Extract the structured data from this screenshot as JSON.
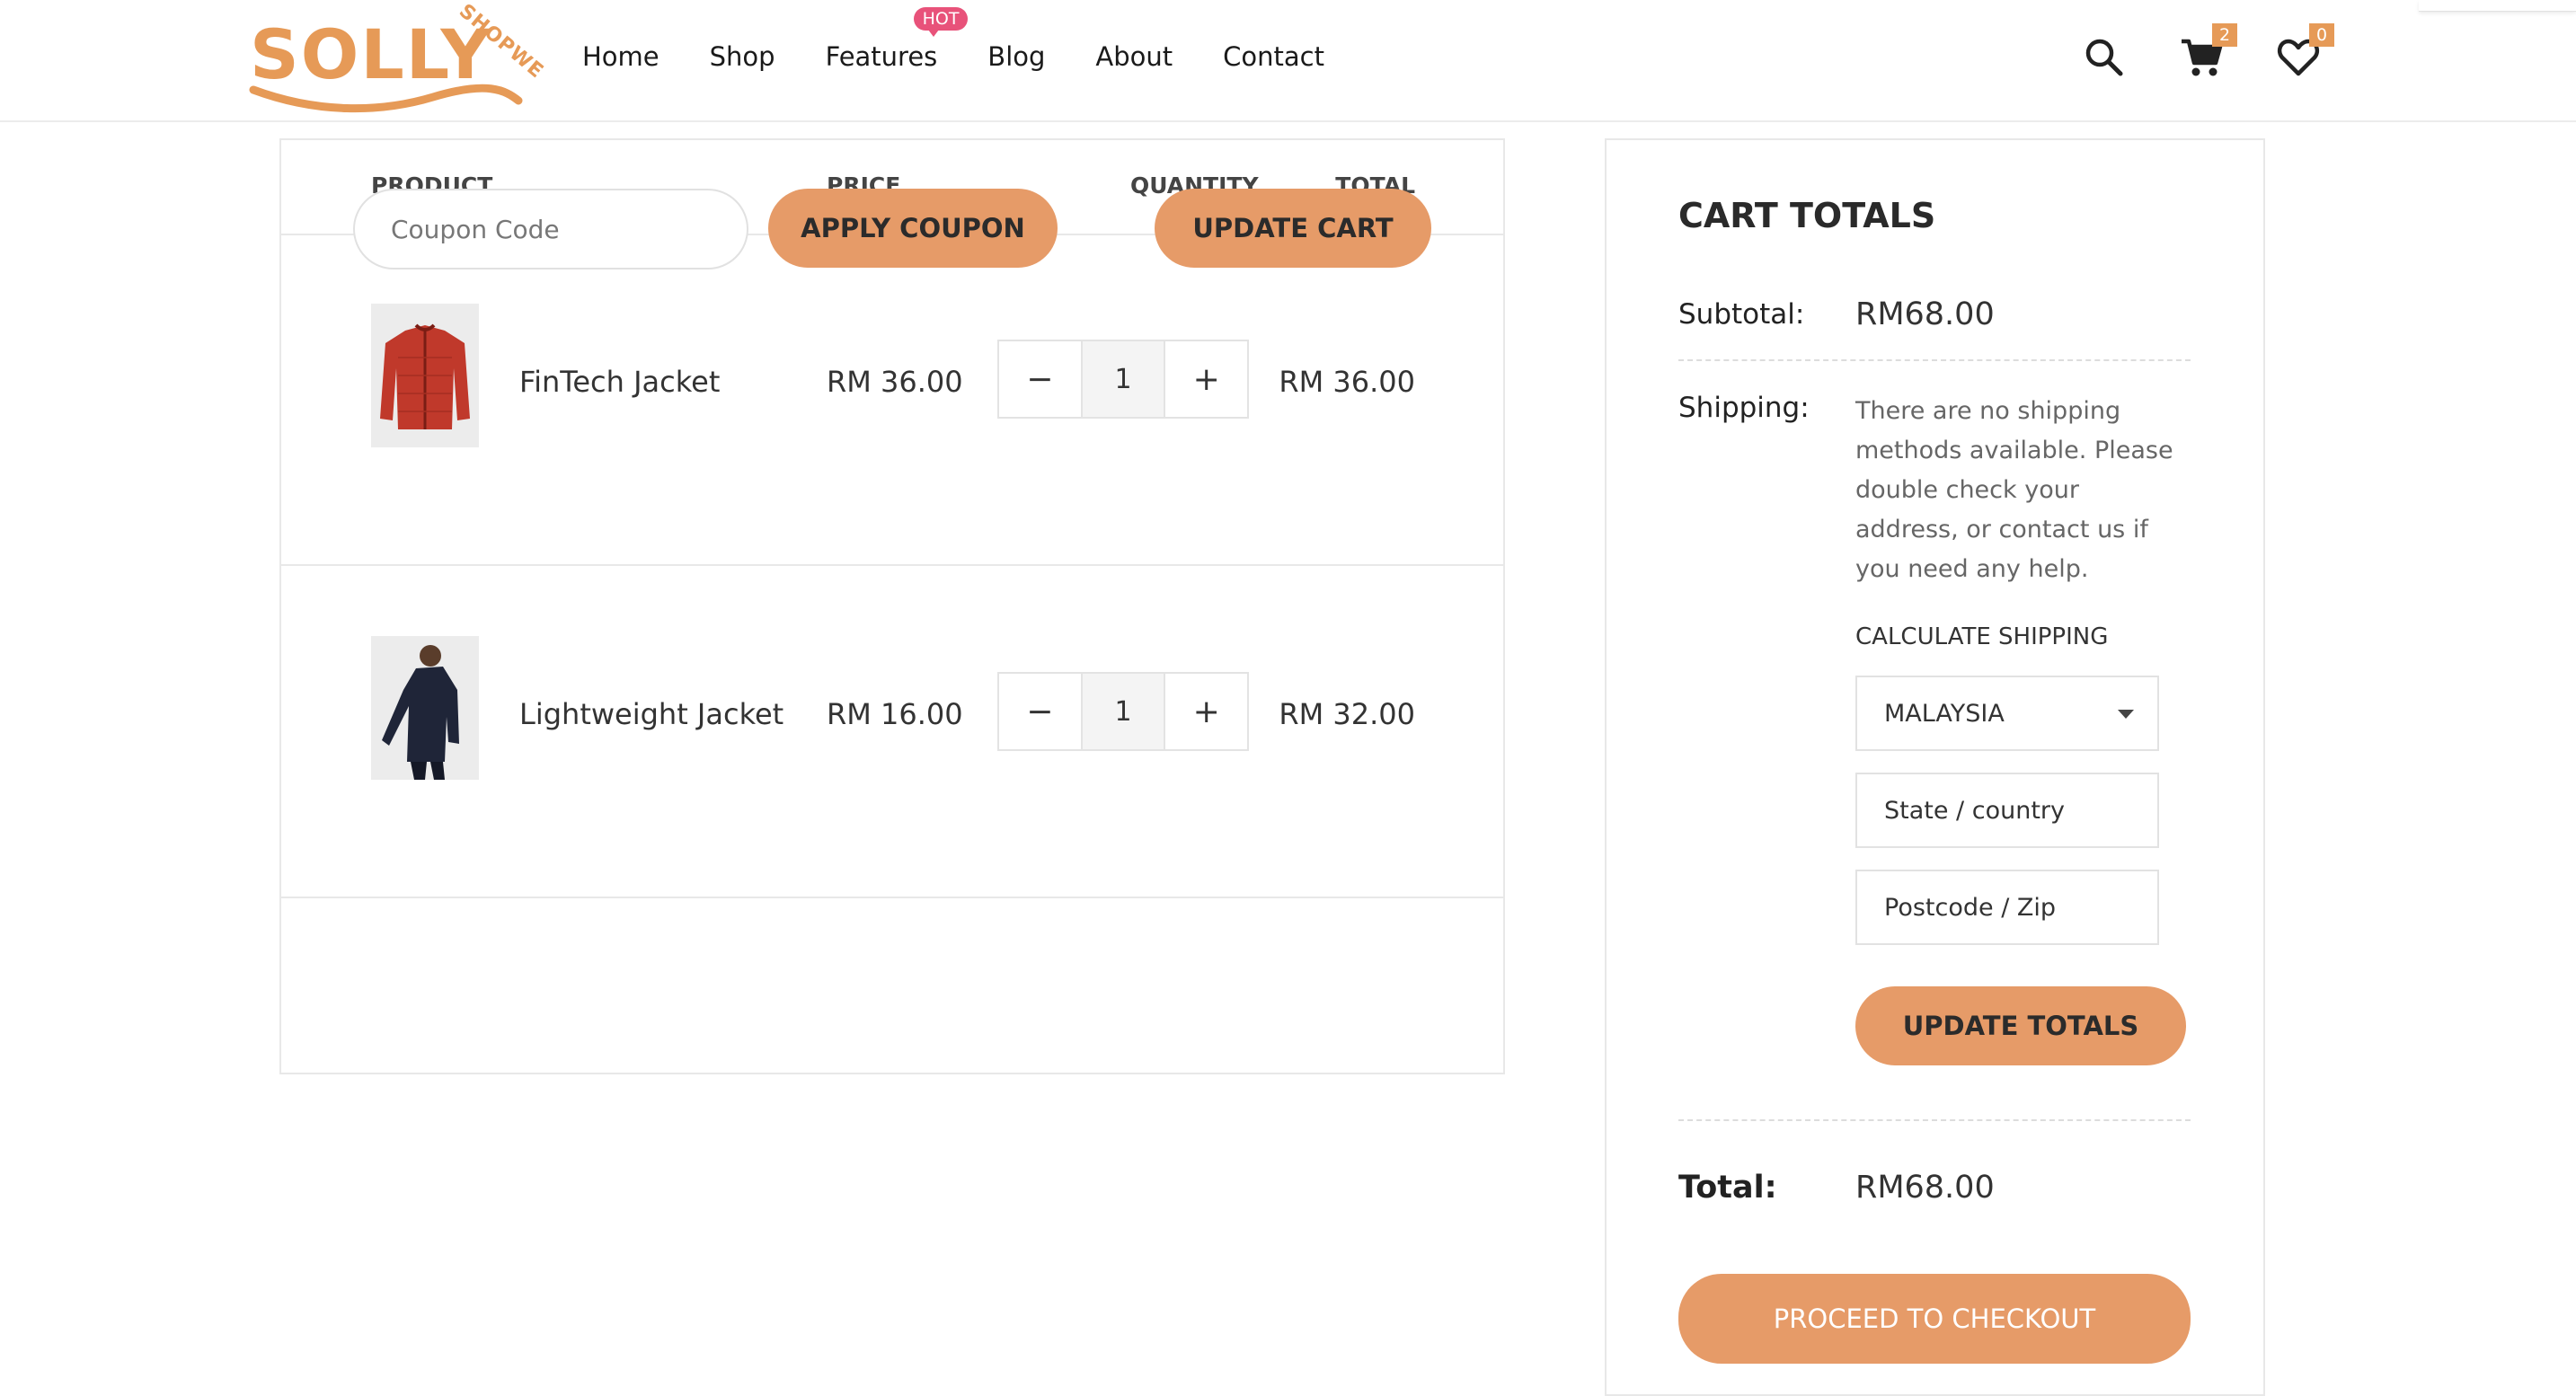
{
  "brand": {
    "logo_text": "SOLLY",
    "logo_subtext": "SHOPWE",
    "color": "#e69a57"
  },
  "nav": {
    "items": [
      "Home",
      "Shop",
      "Features",
      "Blog",
      "About",
      "Contact"
    ],
    "hot_badge": "HOT"
  },
  "header_icons": {
    "search": "search-icon",
    "cart": "cart-icon",
    "cart_count": "2",
    "wishlist": "heart-icon",
    "wishlist_count": "0"
  },
  "cart": {
    "columns": {
      "product": "PRODUCT",
      "price": "PRICE",
      "quantity": "QUANTITY",
      "total": "TOTAL"
    },
    "items": [
      {
        "name": "FinTech Jacket",
        "price": "RM 36.00",
        "qty": "1",
        "total": "RM 36.00",
        "minus": "−",
        "plus": "+"
      },
      {
        "name": "Lightweight Jacket",
        "price": "RM 16.00",
        "qty": "1",
        "total": "RM 32.00",
        "minus": "−",
        "plus": "+"
      }
    ],
    "coupon_placeholder": "Coupon Code",
    "apply_coupon": "APPLY COUPON",
    "update_cart": "UPDATE CART"
  },
  "totals": {
    "title": "CART TOTALS",
    "subtotal_label": "Subtotal:",
    "subtotal_value": "RM68.00",
    "shipping_label": "Shipping:",
    "shipping_note": "There are no shipping methods available. Please double check your address, or contact us if you need any help.",
    "calculate_shipping": "CALCULATE SHIPPING",
    "country": "MALAYSIA",
    "state_placeholder": "State /  country",
    "postcode_placeholder": "Postcode / Zip",
    "update_totals": "UPDATE TOTALS",
    "total_label": "Total:",
    "total_value": "RM68.00",
    "checkout": "PROCEED TO CHECKOUT"
  },
  "accent_color": "#e69b68"
}
